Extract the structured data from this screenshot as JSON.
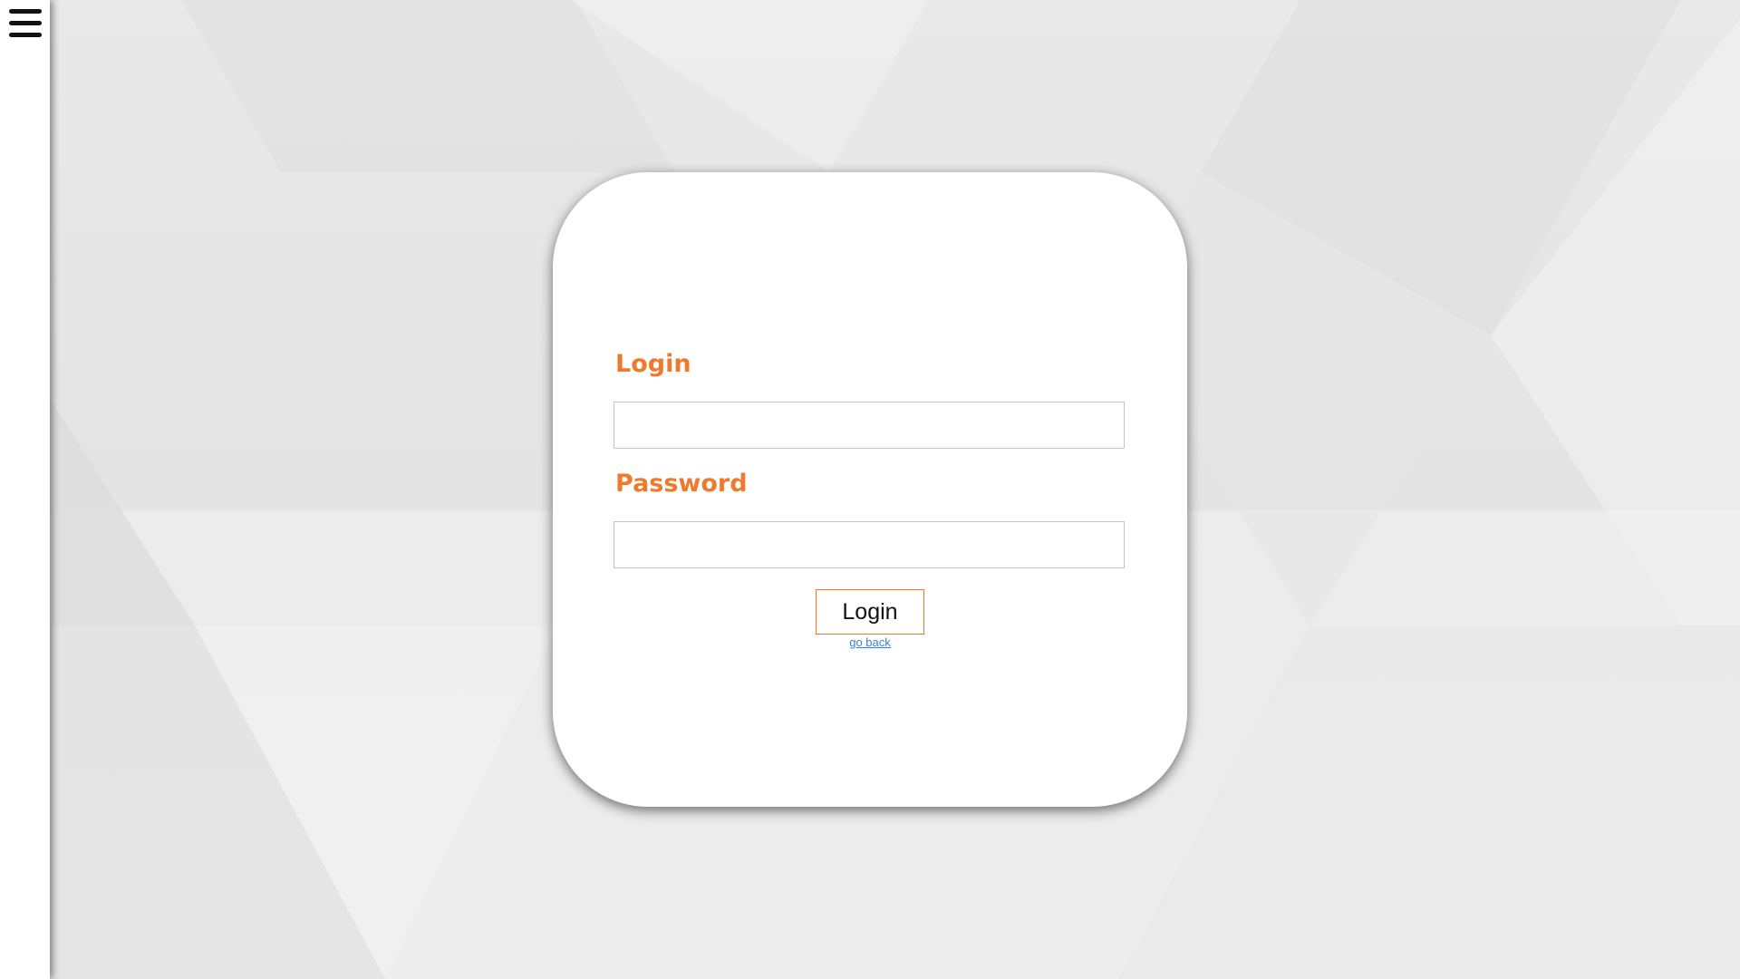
{
  "sidebar": {
    "menu_icon": "hamburger-menu-icon"
  },
  "login_form": {
    "login_label": "Login",
    "login_value": "",
    "password_label": "Password",
    "password_value": "",
    "submit_label": "Login",
    "go_back_label": "go back"
  },
  "colors": {
    "accent": "#f07a2b",
    "link": "#3a7fd6",
    "card_background": "#ffffff",
    "page_background": "#e9e9e9"
  }
}
